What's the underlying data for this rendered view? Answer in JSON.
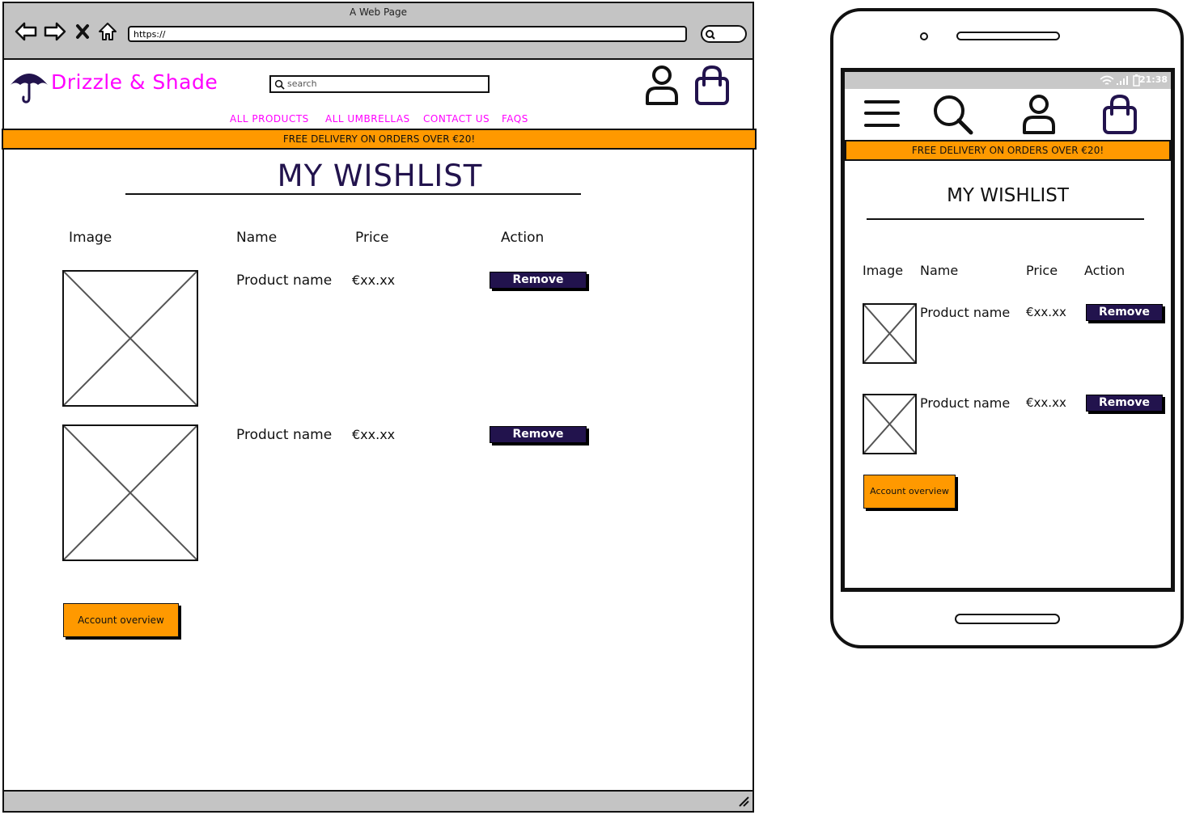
{
  "browser": {
    "window_title": "A Web Page",
    "url": "https://"
  },
  "site": {
    "brand": "Drizzle & Shade",
    "search_placeholder": "search",
    "nav": [
      "ALL PRODUCTS",
      "ALL UMBRELLAS",
      "CONTACT US",
      "FAQS"
    ],
    "banner": "FREE DELIVERY ON ORDERS OVER €20!"
  },
  "wishlist": {
    "title": "MY WISHLIST",
    "columns": [
      "Image",
      "Name",
      "Price",
      "Action"
    ],
    "items": [
      {
        "name": "Product name",
        "price": "€xx.xx",
        "action": "Remove"
      },
      {
        "name": "Product name",
        "price": "€xx.xx",
        "action": "Remove"
      }
    ],
    "account_button": "Account overview"
  },
  "mobile": {
    "time": "21:38",
    "banner": "FREE DELIVERY ON ORDERS OVER €20!",
    "title": "MY WISHLIST",
    "columns": [
      "Image",
      "Name",
      "Price",
      "Action"
    ],
    "items": [
      {
        "name": "Product name",
        "price": "€xx.xx",
        "action": "Remove"
      },
      {
        "name": "Product name",
        "price": "€xx.xx",
        "action": "Remove"
      }
    ],
    "account_button": "Account overview"
  },
  "colors": {
    "brand_pink": "#ff00ff",
    "banner_orange": "#ff9900",
    "primary_dark": "#22134d",
    "chrome_gray": "#c4c4c4"
  },
  "icons": [
    "back-arrow-icon",
    "forward-arrow-icon",
    "stop-icon",
    "home-icon",
    "search-icon",
    "umbrella-icon",
    "user-icon",
    "shopping-bag-icon",
    "menu-icon",
    "wifi-icon",
    "signal-icon",
    "battery-icon",
    "resize-grip-icon"
  ]
}
